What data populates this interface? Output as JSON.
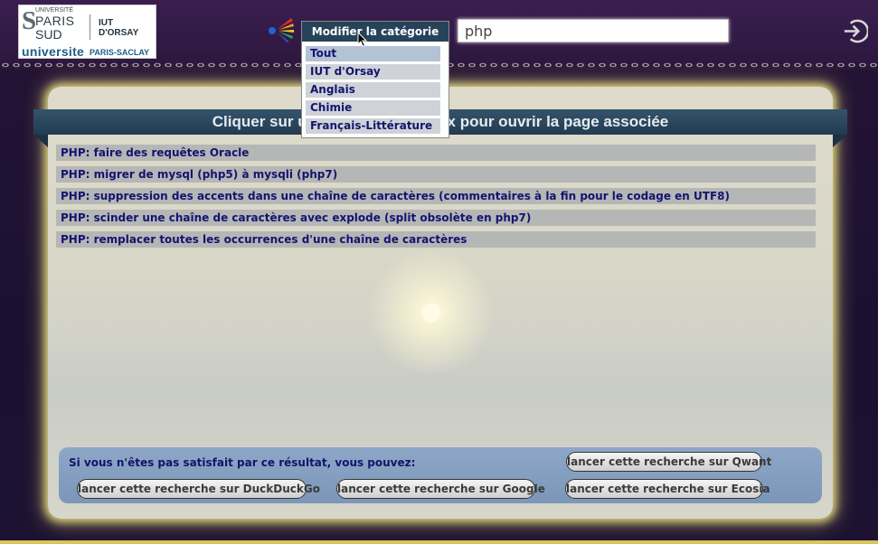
{
  "header": {
    "logo": {
      "university_small": "UNIVERSITÉ",
      "paris": "PARIS",
      "sud": "SUD",
      "iut": "IUT D'ORSAY",
      "universite": "universite",
      "paris_saclay": "PARIS-SACLAY"
    },
    "search": {
      "value": "php",
      "placeholder": ""
    }
  },
  "main": {
    "title": "Cliquer sur un lien de votre choix pour ouvrir la page associée",
    "results": [
      "PHP: faire des requêtes Oracle",
      "PHP: migrer de mysql (php5) à mysqli (php7)",
      "PHP: suppression des accents dans une chaîne de caractères (commentaires à la fin pour le codage en UTF8)",
      "PHP: scinder une chaîne de caractères avec explode (split obsolète en php7)",
      "PHP: remplacer toutes les occurrences d'une chaîne de caractères"
    ]
  },
  "alt_search": {
    "text": "Si vous n'êtes pas satisfait par ce résultat, vous pouvez:",
    "qwant": "lancer cette recherche sur Qwant",
    "duckduckgo": "lancer cette recherche sur DuckDuckGo",
    "google": "lancer cette recherche sur Google",
    "ecosia": "lancer cette recherche sur Ecosia"
  },
  "category_menu": {
    "header": "Modifier la catégorie",
    "items": [
      "Tout",
      "IUT d'Orsay",
      "Anglais",
      "Chimie",
      "Français-Littérature"
    ],
    "selected": "Tout"
  },
  "colors": {
    "header_bg": "#3a1f4e",
    "title_band": "#2c4860",
    "link_text": "#14146e",
    "panel_glow": "#e6dc80"
  }
}
